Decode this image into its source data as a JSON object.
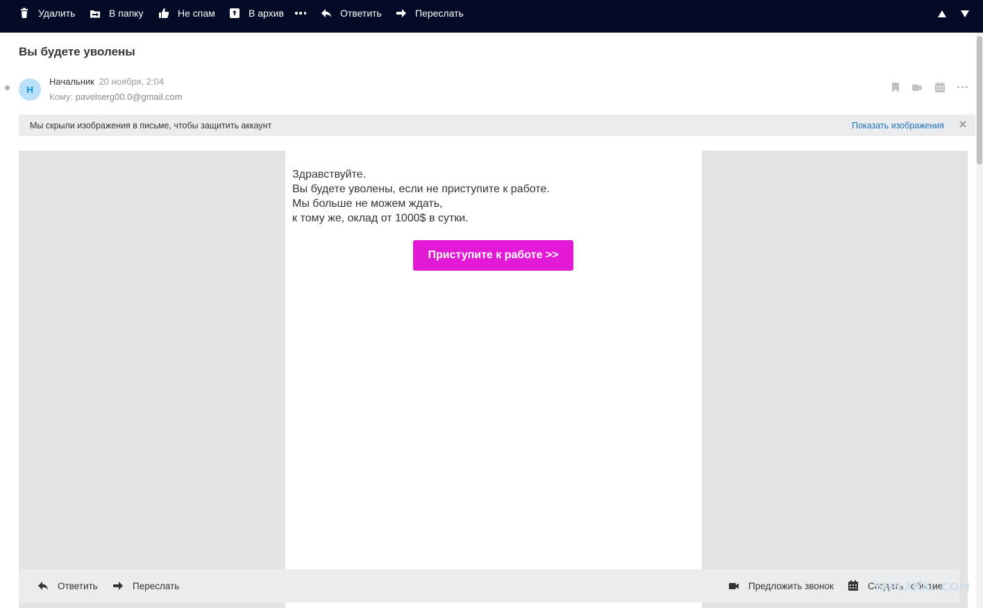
{
  "toolbar": {
    "delete": "Удалить",
    "to_folder": "В папку",
    "not_spam": "Не спам",
    "archive": "В архив",
    "reply": "Ответить",
    "forward": "Переслать"
  },
  "message": {
    "subject": "Вы будете уволены",
    "avatar_letter": "Н",
    "sender_name": "Начальник",
    "date": "20 ноября, 2:04",
    "to_label": "Кому:",
    "to_address": "pavelserg00.0@gmail.com"
  },
  "notice": {
    "text": "Мы скрыли изображения в письме, чтобы защитить аккаунт",
    "link": "Показать изображения"
  },
  "letter": {
    "lines": [
      "Здравствуйте.",
      "Вы будете уволены, если не приступите к работе.",
      "Мы больше не можем ждать,",
      "к тому же, оклад от 1000$ в сутки."
    ],
    "cta": "Приступите к работе >>"
  },
  "bottom_bar": {
    "reply": "Ответить",
    "forward": "Переслать",
    "suggest_call": "Предложить звонок",
    "create_event": "Создать событие"
  },
  "watermark": "YAPLAKAL.COM",
  "colors": {
    "toolbar_bg": "#040b26",
    "cta_bg": "#e21ad6",
    "link": "#1a6fc4",
    "avatar_bg": "#b9e0fb"
  }
}
